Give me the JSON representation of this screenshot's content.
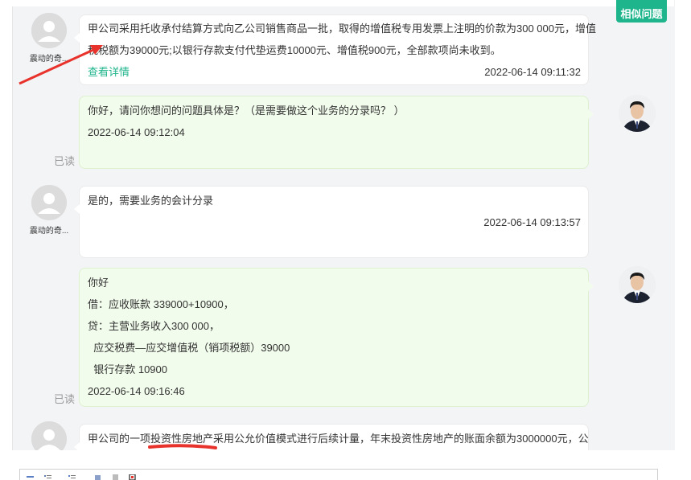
{
  "related_button_label": "相似问题",
  "messages": [
    {
      "side": "left",
      "user_name": "震动的奇...",
      "lines": [
        "甲公司采用托收承付结算方式向乙公司销售商品一批，取得的增值税专用发票上注明的价款为300 000元，增值",
        "税税额为39000元;以银行存款支付代垫运费10000元、增值税900元，全部款项尚未收到。"
      ],
      "link": "查看详情",
      "time": "2022-06-14 09:11:32"
    },
    {
      "side": "right",
      "lines": [
        "你好，请问你想问的问题具体是？（是需要做这个业务的分录吗？ ）"
      ],
      "time": "2022-06-14 09:12:04",
      "read": "已读"
    },
    {
      "side": "left",
      "user_name": "震动的奇...",
      "lines": [
        "是的，需要业务的会计分录"
      ],
      "time": "2022-06-14 09:13:57"
    },
    {
      "side": "right",
      "lines": [
        "你好",
        "借：应收账款 339000+10900，",
        "贷：主营业务收入300 000，",
        "  应交税费—应交增值税（销项税额）39000",
        "  银行存款 10900"
      ],
      "time": "2022-06-14 09:16:46",
      "read": "已读"
    },
    {
      "side": "left",
      "user_name": "",
      "lines": [
        "甲公司的一项投资性房地产采用公允价值模式进行后续计量，年末投资性房地产的账面余额为3000000元，公"
      ]
    }
  ],
  "colors": {
    "accent": "#1fb58c",
    "annotation_red": "#e8322c",
    "expert_bubble": "#f2fcec",
    "user_bubble": "#ffffff"
  }
}
